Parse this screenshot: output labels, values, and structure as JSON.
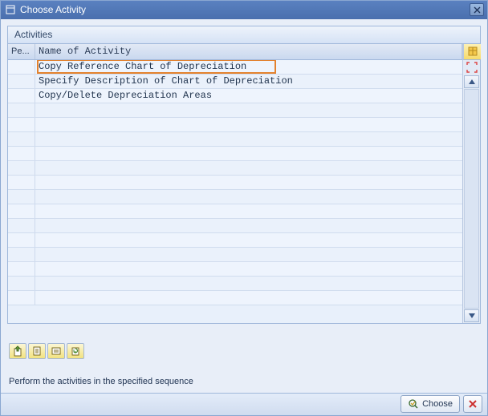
{
  "dialog": {
    "title": "Choose Activity"
  },
  "panel": {
    "title": "Activities",
    "columns": {
      "pe": "Pe...",
      "name": "Name of Activity"
    },
    "rows": [
      "Copy Reference Chart of Depreciation",
      "Specify Description of Chart of Depreciation",
      "Copy/Delete Depreciation Areas"
    ],
    "highlighted_index": 0
  },
  "instruction": "Perform the activities in the specified sequence",
  "footer": {
    "choose": "Choose"
  }
}
